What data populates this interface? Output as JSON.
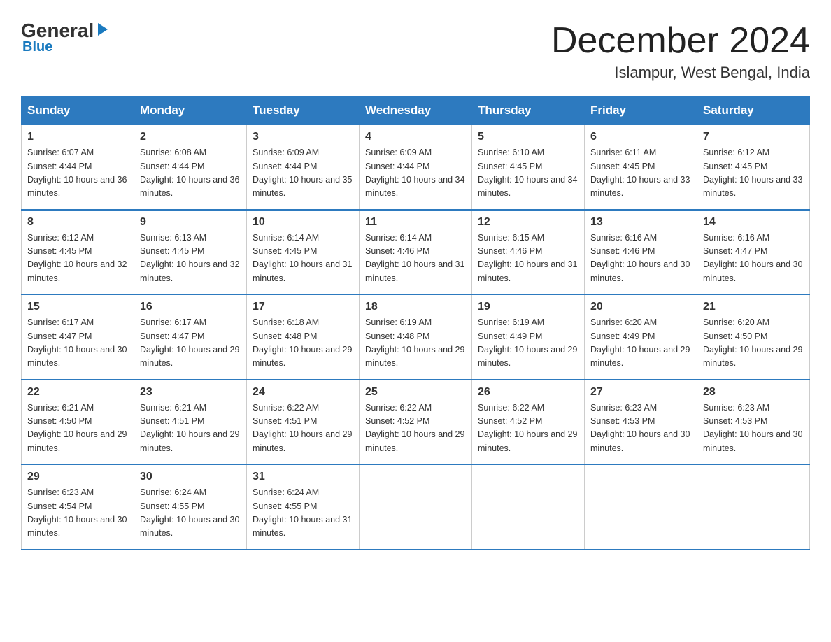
{
  "logo": {
    "general": "General",
    "blue": "Blue",
    "arrow": "▶"
  },
  "title": "December 2024",
  "subtitle": "Islampur, West Bengal, India",
  "days_of_week": [
    "Sunday",
    "Monday",
    "Tuesday",
    "Wednesday",
    "Thursday",
    "Friday",
    "Saturday"
  ],
  "weeks": [
    [
      {
        "day": "1",
        "sunrise": "6:07 AM",
        "sunset": "4:44 PM",
        "daylight": "10 hours and 36 minutes."
      },
      {
        "day": "2",
        "sunrise": "6:08 AM",
        "sunset": "4:44 PM",
        "daylight": "10 hours and 36 minutes."
      },
      {
        "day": "3",
        "sunrise": "6:09 AM",
        "sunset": "4:44 PM",
        "daylight": "10 hours and 35 minutes."
      },
      {
        "day": "4",
        "sunrise": "6:09 AM",
        "sunset": "4:44 PM",
        "daylight": "10 hours and 34 minutes."
      },
      {
        "day": "5",
        "sunrise": "6:10 AM",
        "sunset": "4:45 PM",
        "daylight": "10 hours and 34 minutes."
      },
      {
        "day": "6",
        "sunrise": "6:11 AM",
        "sunset": "4:45 PM",
        "daylight": "10 hours and 33 minutes."
      },
      {
        "day": "7",
        "sunrise": "6:12 AM",
        "sunset": "4:45 PM",
        "daylight": "10 hours and 33 minutes."
      }
    ],
    [
      {
        "day": "8",
        "sunrise": "6:12 AM",
        "sunset": "4:45 PM",
        "daylight": "10 hours and 32 minutes."
      },
      {
        "day": "9",
        "sunrise": "6:13 AM",
        "sunset": "4:45 PM",
        "daylight": "10 hours and 32 minutes."
      },
      {
        "day": "10",
        "sunrise": "6:14 AM",
        "sunset": "4:45 PM",
        "daylight": "10 hours and 31 minutes."
      },
      {
        "day": "11",
        "sunrise": "6:14 AM",
        "sunset": "4:46 PM",
        "daylight": "10 hours and 31 minutes."
      },
      {
        "day": "12",
        "sunrise": "6:15 AM",
        "sunset": "4:46 PM",
        "daylight": "10 hours and 31 minutes."
      },
      {
        "day": "13",
        "sunrise": "6:16 AM",
        "sunset": "4:46 PM",
        "daylight": "10 hours and 30 minutes."
      },
      {
        "day": "14",
        "sunrise": "6:16 AM",
        "sunset": "4:47 PM",
        "daylight": "10 hours and 30 minutes."
      }
    ],
    [
      {
        "day": "15",
        "sunrise": "6:17 AM",
        "sunset": "4:47 PM",
        "daylight": "10 hours and 30 minutes."
      },
      {
        "day": "16",
        "sunrise": "6:17 AM",
        "sunset": "4:47 PM",
        "daylight": "10 hours and 29 minutes."
      },
      {
        "day": "17",
        "sunrise": "6:18 AM",
        "sunset": "4:48 PM",
        "daylight": "10 hours and 29 minutes."
      },
      {
        "day": "18",
        "sunrise": "6:19 AM",
        "sunset": "4:48 PM",
        "daylight": "10 hours and 29 minutes."
      },
      {
        "day": "19",
        "sunrise": "6:19 AM",
        "sunset": "4:49 PM",
        "daylight": "10 hours and 29 minutes."
      },
      {
        "day": "20",
        "sunrise": "6:20 AM",
        "sunset": "4:49 PM",
        "daylight": "10 hours and 29 minutes."
      },
      {
        "day": "21",
        "sunrise": "6:20 AM",
        "sunset": "4:50 PM",
        "daylight": "10 hours and 29 minutes."
      }
    ],
    [
      {
        "day": "22",
        "sunrise": "6:21 AM",
        "sunset": "4:50 PM",
        "daylight": "10 hours and 29 minutes."
      },
      {
        "day": "23",
        "sunrise": "6:21 AM",
        "sunset": "4:51 PM",
        "daylight": "10 hours and 29 minutes."
      },
      {
        "day": "24",
        "sunrise": "6:22 AM",
        "sunset": "4:51 PM",
        "daylight": "10 hours and 29 minutes."
      },
      {
        "day": "25",
        "sunrise": "6:22 AM",
        "sunset": "4:52 PM",
        "daylight": "10 hours and 29 minutes."
      },
      {
        "day": "26",
        "sunrise": "6:22 AM",
        "sunset": "4:52 PM",
        "daylight": "10 hours and 29 minutes."
      },
      {
        "day": "27",
        "sunrise": "6:23 AM",
        "sunset": "4:53 PM",
        "daylight": "10 hours and 30 minutes."
      },
      {
        "day": "28",
        "sunrise": "6:23 AM",
        "sunset": "4:53 PM",
        "daylight": "10 hours and 30 minutes."
      }
    ],
    [
      {
        "day": "29",
        "sunrise": "6:23 AM",
        "sunset": "4:54 PM",
        "daylight": "10 hours and 30 minutes."
      },
      {
        "day": "30",
        "sunrise": "6:24 AM",
        "sunset": "4:55 PM",
        "daylight": "10 hours and 30 minutes."
      },
      {
        "day": "31",
        "sunrise": "6:24 AM",
        "sunset": "4:55 PM",
        "daylight": "10 hours and 31 minutes."
      },
      null,
      null,
      null,
      null
    ]
  ]
}
